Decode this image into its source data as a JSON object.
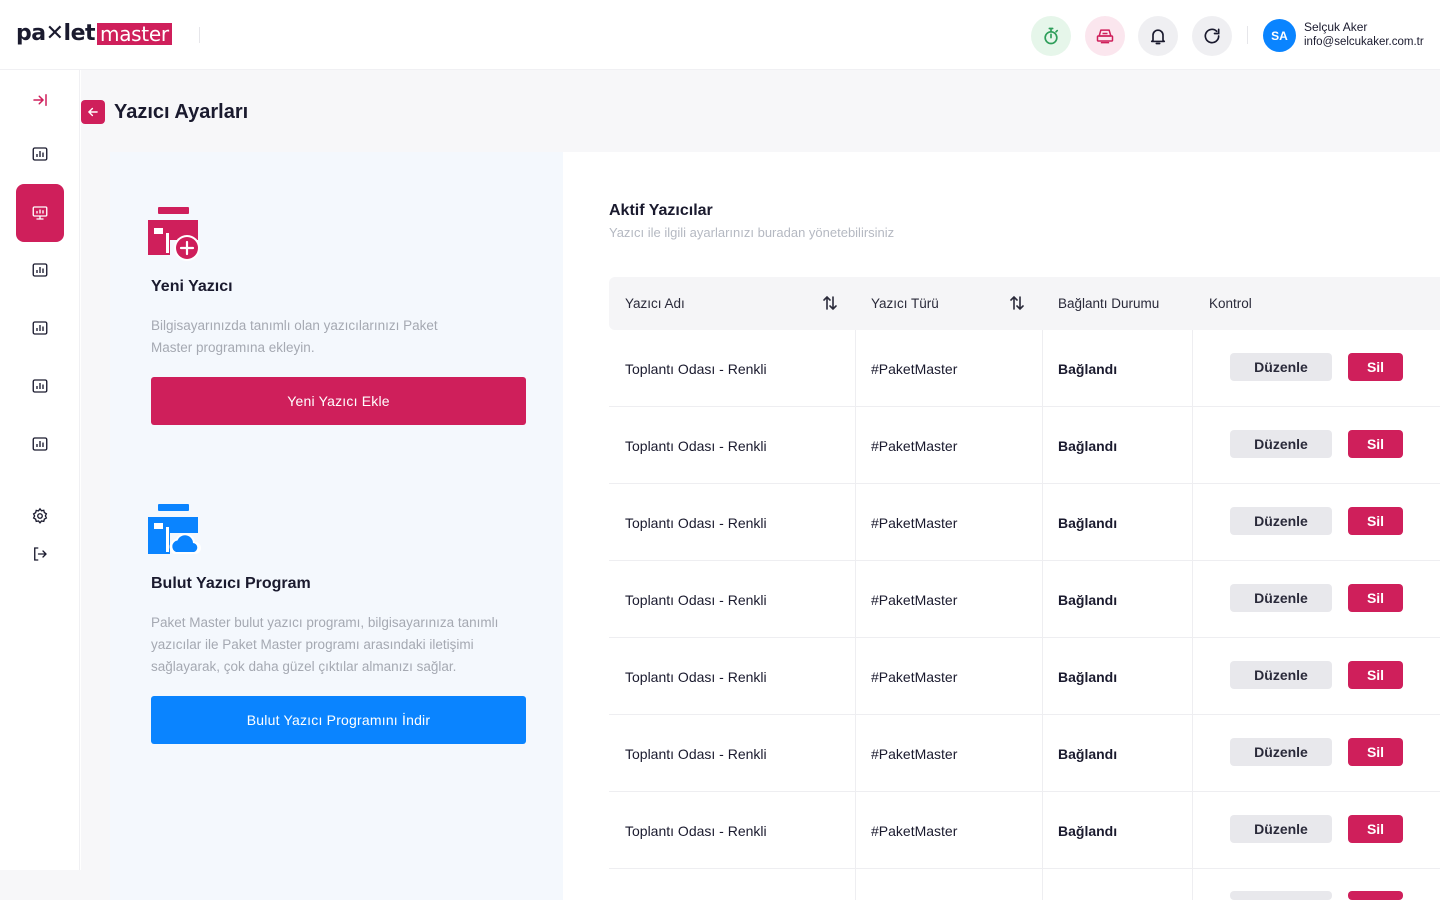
{
  "header": {
    "logo_part1": "pa✕let",
    "logo_part2": "master",
    "user_initials": "SA",
    "user_name": "Selçuk Aker",
    "user_email": "info@selcukaker.com.tr",
    "icons": [
      "timer-icon",
      "printer-icon",
      "bell-icon",
      "refresh-icon"
    ]
  },
  "sidebar": {
    "items": [
      "expand-icon",
      "chart-icon",
      "presentation-icon",
      "chart-icon",
      "chart-icon",
      "chart-icon",
      "chart-icon",
      "settings-icon",
      "logout-icon"
    ],
    "active_index": 2
  },
  "page": {
    "title": "Yazıcı Ayarları"
  },
  "new_printer": {
    "title": "Yeni Yazıcı",
    "description": "Bilgisayarınızda tanımlı olan yazıcılarınızı Paket Master programına ekleyin.",
    "button": "Yeni Yazıcı Ekle"
  },
  "cloud_printer": {
    "title": "Bulut Yazıcı Program",
    "description": "Paket Master bulut yazıcı programı, bilgisayarınıza tanımlı yazıcılar ile Paket Master programı arasındaki iletişimi sağlayarak, çok daha güzel çıktılar almanızı sağlar.",
    "button": "Bulut Yazıcı Programını İndir"
  },
  "active_printers": {
    "title": "Aktif Yazıcılar",
    "subtitle": "Yazıcı ile ilgili ayarlarınızı buradan yönetebilirsiniz",
    "columns": [
      "Yazıcı Adı",
      "Yazıcı Türü",
      "Bağlantı Durumu",
      "Kontrol"
    ],
    "edit_label": "Düzenle",
    "delete_label": "Sil",
    "rows": [
      {
        "name": "Toplantı Odası - Renkli",
        "type": "#PaketMaster",
        "status": "Bağlandı"
      },
      {
        "name": "Toplantı Odası - Renkli",
        "type": "#PaketMaster",
        "status": "Bağlandı"
      },
      {
        "name": "Toplantı Odası - Renkli",
        "type": "#PaketMaster",
        "status": "Bağlandı"
      },
      {
        "name": "Toplantı Odası - Renkli",
        "type": "#PaketMaster",
        "status": "Bağlandı"
      },
      {
        "name": "Toplantı Odası - Renkli",
        "type": "#PaketMaster",
        "status": "Bağlandı"
      },
      {
        "name": "Toplantı Odası - Renkli",
        "type": "#PaketMaster",
        "status": "Bağlandı"
      },
      {
        "name": "Toplantı Odası - Renkli",
        "type": "#PaketMaster",
        "status": "Bağlandı"
      }
    ]
  },
  "colors": {
    "brand": "#cf1f5b",
    "blue": "#0a84ff",
    "success": "#2e9e5a"
  }
}
